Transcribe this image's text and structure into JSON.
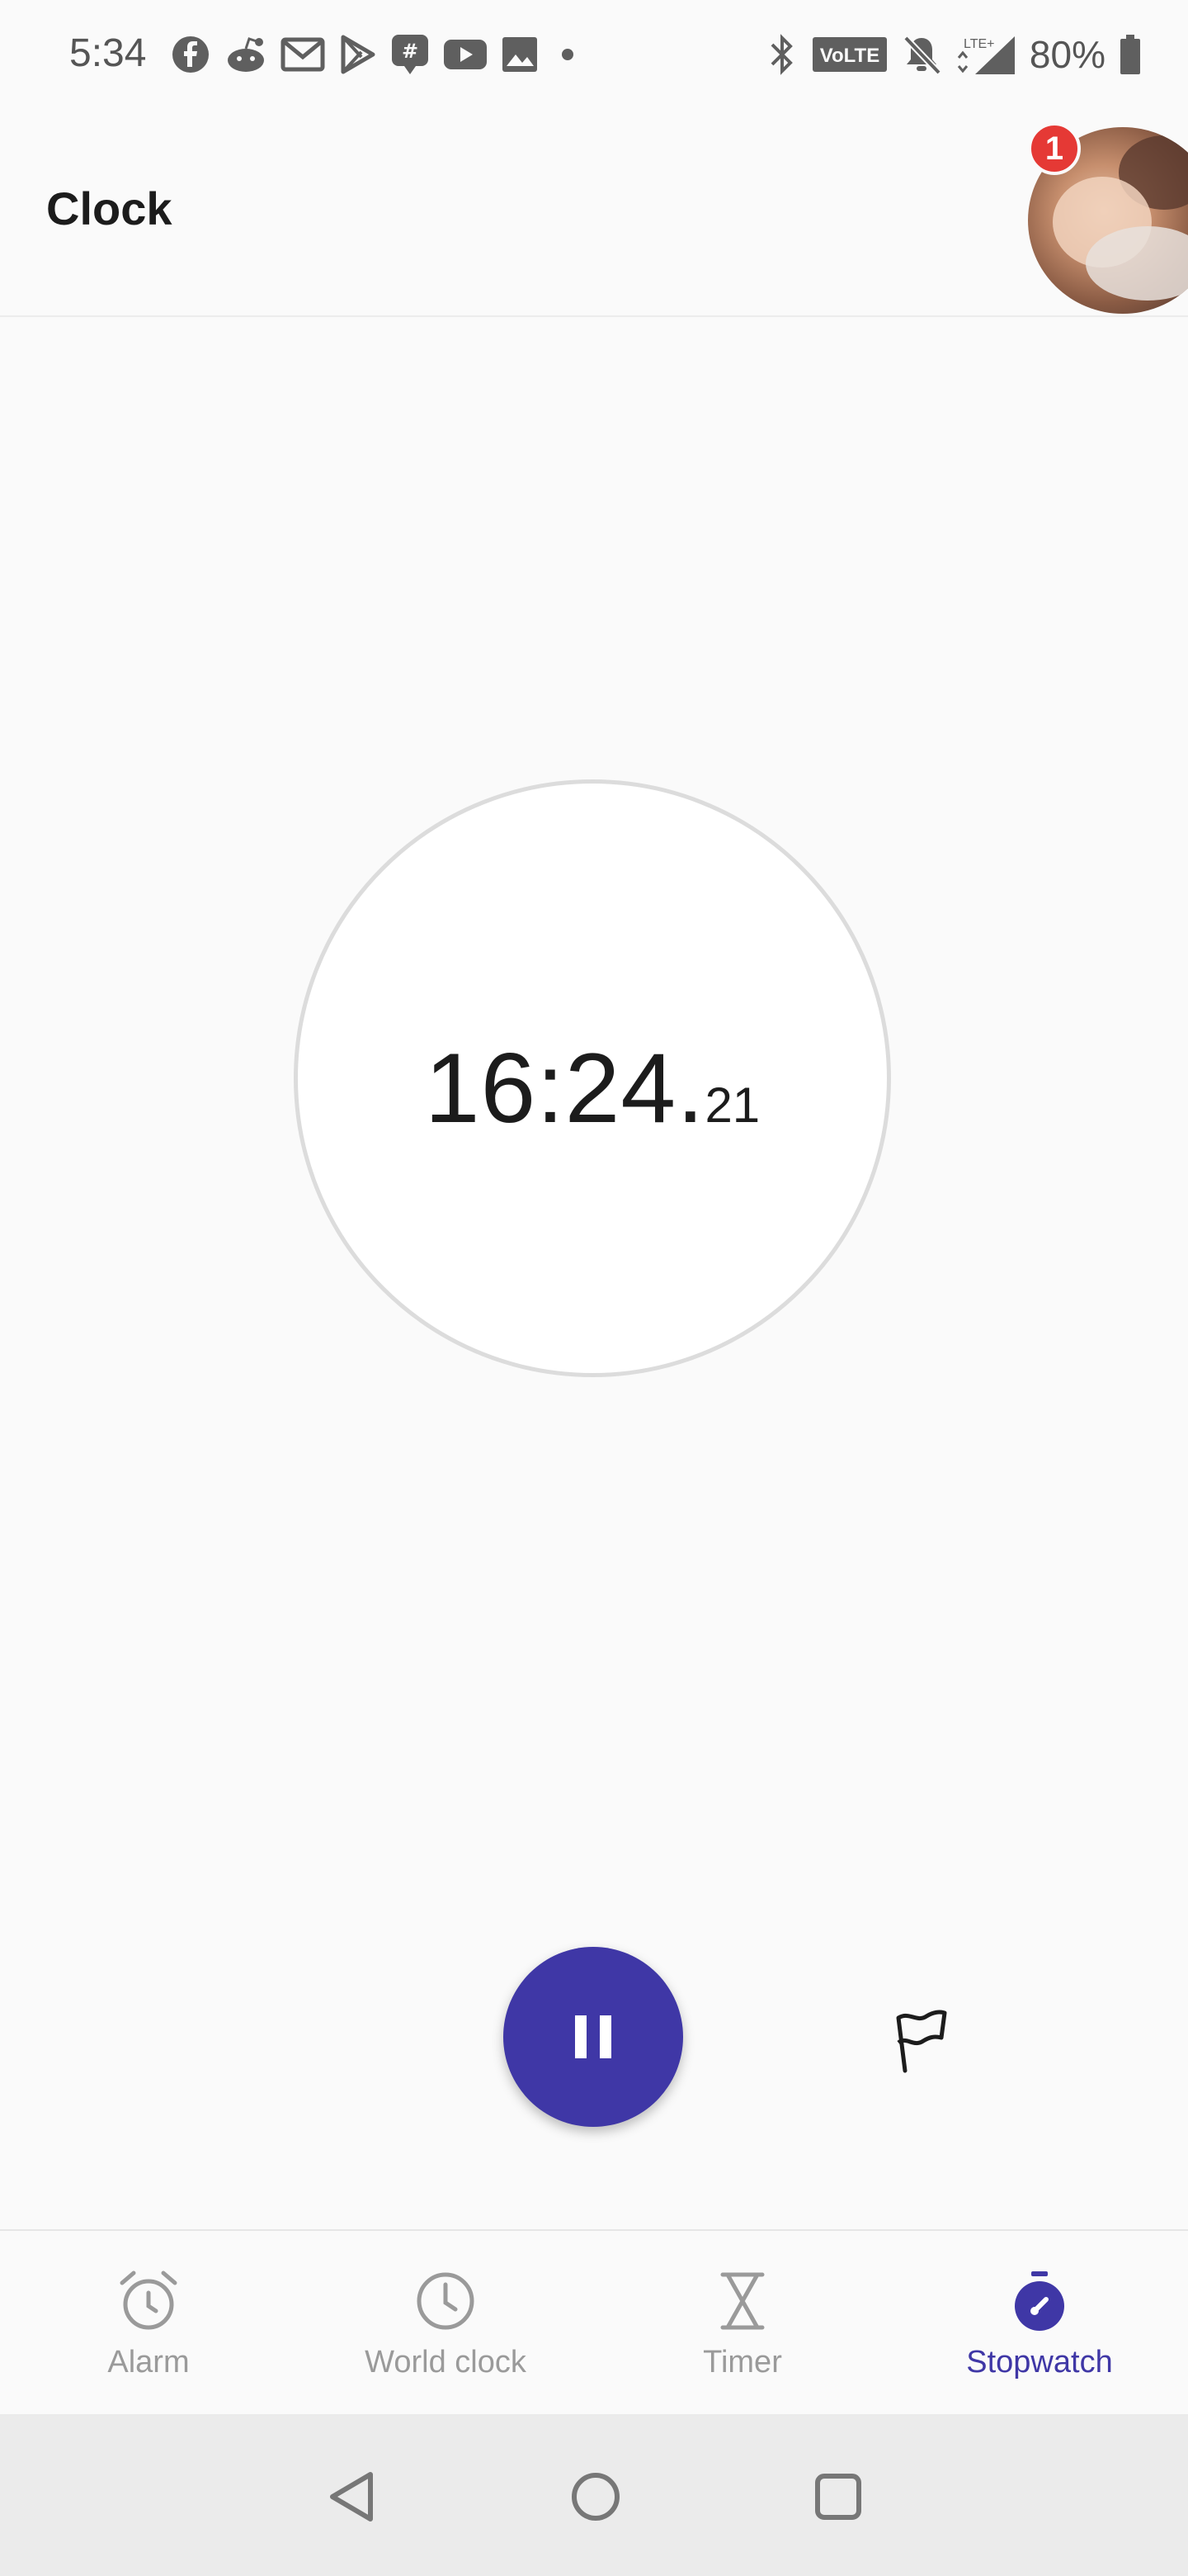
{
  "status_bar": {
    "time": "5:34",
    "battery": "80%",
    "notification_icons": [
      "facebook-icon",
      "reddit-icon",
      "gmail-icon",
      "play-store-icon",
      "groupme-icon",
      "youtube-icon",
      "photos-icon",
      "dot-icon"
    ],
    "system_icons": [
      "bluetooth-icon",
      "volte-icon",
      "bell-off-icon",
      "lte-signal-icon",
      "battery-icon"
    ],
    "volte_label": "VoLTE"
  },
  "app_bar": {
    "title": "Clock",
    "avatar_badge": "1"
  },
  "stopwatch": {
    "time_main": "16:24.",
    "time_centiseconds": "21"
  },
  "controls": {
    "pause_icon": "pause-icon",
    "lap_icon": "flag-icon"
  },
  "bottom_nav": {
    "items": [
      {
        "label": "Alarm",
        "icon": "alarm-icon",
        "active": false
      },
      {
        "label": "World clock",
        "icon": "world-clock-icon",
        "active": false
      },
      {
        "label": "Timer",
        "icon": "hourglass-icon",
        "active": false
      },
      {
        "label": "Stopwatch",
        "icon": "stopwatch-icon",
        "active": true
      }
    ]
  },
  "colors": {
    "accent": "#3f37a6",
    "badge": "#e53935",
    "inactive": "#9a9a9a"
  }
}
